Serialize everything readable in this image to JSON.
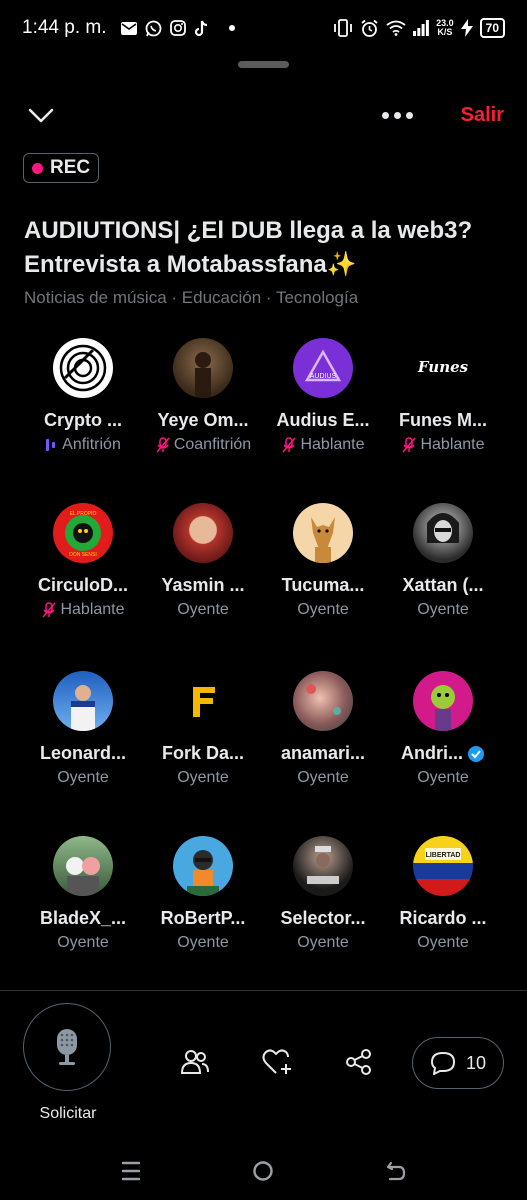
{
  "status": {
    "time": "1:44 p. m.",
    "netspeed_value": "23.0",
    "netspeed_unit": "K/S",
    "battery": "70",
    "notif_icons": [
      "mail-icon",
      "whatsapp-icon",
      "instagram-icon",
      "tiktok-icon",
      "dot-icon"
    ],
    "sys_icons": [
      "vibrate-icon",
      "alarm-icon",
      "wifi-icon",
      "signal-icon",
      "netspeed",
      "charging-icon",
      "battery"
    ]
  },
  "header": {
    "exit_label": "Salir",
    "rec_label": "REC"
  },
  "space": {
    "title": "AUDIUTIONS| ¿El DUB llega a la web3? Entrevista a Motabassfana✨",
    "topics": "Noticias de música · Educación · Tecnología"
  },
  "participants": [
    {
      "name": "Crypto ...",
      "role": "Anfitrión",
      "role_icon": "speaking-icon"
    },
    {
      "name": "Yeye Om...",
      "role": "Coanfitrión",
      "role_icon": "mic-muted-icon"
    },
    {
      "name": "Audius E...",
      "role": "Hablante",
      "role_icon": "mic-muted-icon"
    },
    {
      "name": "Funes M...",
      "role": "Hablante",
      "role_icon": "mic-muted-icon"
    },
    {
      "name": "CirculoD...",
      "role": "Hablante",
      "role_icon": "mic-muted-icon"
    },
    {
      "name": "Yasmin ...",
      "role": "Oyente",
      "role_icon": ""
    },
    {
      "name": "Tucuma...",
      "role": "Oyente",
      "role_icon": ""
    },
    {
      "name": "Xattan (...",
      "role": "Oyente",
      "role_icon": ""
    },
    {
      "name": "Leonard...",
      "role": "Oyente",
      "role_icon": ""
    },
    {
      "name": "Fork Da...",
      "role": "Oyente",
      "role_icon": ""
    },
    {
      "name": "anamari...",
      "role": "Oyente",
      "role_icon": ""
    },
    {
      "name": "Andri...",
      "role": "Oyente",
      "role_icon": "",
      "verified": true
    },
    {
      "name": "BladeX_...",
      "role": "Oyente",
      "role_icon": ""
    },
    {
      "name": "RoBertP...",
      "role": "Oyente",
      "role_icon": ""
    },
    {
      "name": "Selector...",
      "role": "Oyente",
      "role_icon": ""
    },
    {
      "name": "Ricardo ...",
      "role": "Oyente",
      "role_icon": ""
    }
  ],
  "avatar_texts": {
    "funes_logo": "Funes",
    "audius_logo": "AUDIUS",
    "circulo_logo_top": "EL PROPIO",
    "circulo_logo_bottom": "DON SENSI",
    "ricardo_flag": "LIBERTAD"
  },
  "footer": {
    "request_label": "Solicitar",
    "comment_count": "10"
  },
  "colors": {
    "accent_red": "#f4212e",
    "rec_dot": "#f91880",
    "muted_mic": "#f91880",
    "speaking": "#7856ff",
    "verified": "#1d9bf0"
  }
}
